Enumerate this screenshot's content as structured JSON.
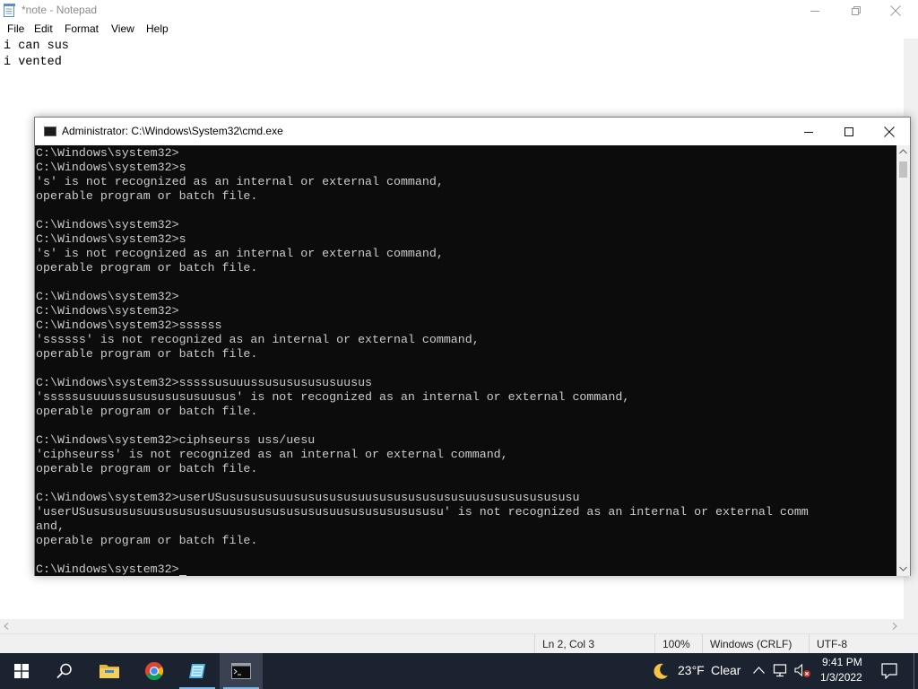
{
  "notepad": {
    "title": "*note - Notepad",
    "menu": [
      "File",
      "Edit",
      "Format",
      "View",
      "Help"
    ],
    "lines": [
      "i can sus",
      "i vented"
    ],
    "status": {
      "position": "Ln 2, Col 3",
      "zoom": "100%",
      "line_ending": "Windows (CRLF)",
      "encoding": "UTF-8"
    }
  },
  "cmd": {
    "title": "Administrator: C:\\Windows\\System32\\cmd.exe",
    "lines": [
      "C:\\Windows\\system32>",
      "C:\\Windows\\system32>s",
      "'s' is not recognized as an internal or external command,",
      "operable program or batch file.",
      "",
      "C:\\Windows\\system32>",
      "C:\\Windows\\system32>s",
      "'s' is not recognized as an internal or external command,",
      "operable program or batch file.",
      "",
      "C:\\Windows\\system32>",
      "C:\\Windows\\system32>",
      "C:\\Windows\\system32>ssssss",
      "'ssssss' is not recognized as an internal or external command,",
      "operable program or batch file.",
      "",
      "C:\\Windows\\system32>sssssusuuussusususususuusus",
      "'sssssusuuussusususususuusus' is not recognized as an internal or external command,",
      "operable program or batch file.",
      "",
      "C:\\Windows\\system32>ciphseurss uss/uesu",
      "'ciphseurss' is not recognized as an internal or external command,",
      "operable program or batch file.",
      "",
      "C:\\Windows\\system32>userUSususususuusususususuusususususususuusususususususu",
      "'userUSususususuusususususuusususususususuusususususususu' is not recognized as an internal or external comm",
      "and,",
      "operable program or batch file.",
      "",
      "C:\\Windows\\system32>"
    ]
  },
  "taskbar": {
    "items": [
      "start-icon",
      "search-icon",
      "file-explorer-icon",
      "chrome-icon",
      "notepad-icon",
      "cmd-icon"
    ],
    "weather": {
      "temp": "23°F",
      "condition": "Clear"
    },
    "clock": {
      "time": "9:41 PM",
      "date": "1/3/2022"
    }
  },
  "colors": {
    "console_bg": "#0c0c0c",
    "console_fg": "#cccccc",
    "taskbar_bg": "#1c2330"
  }
}
